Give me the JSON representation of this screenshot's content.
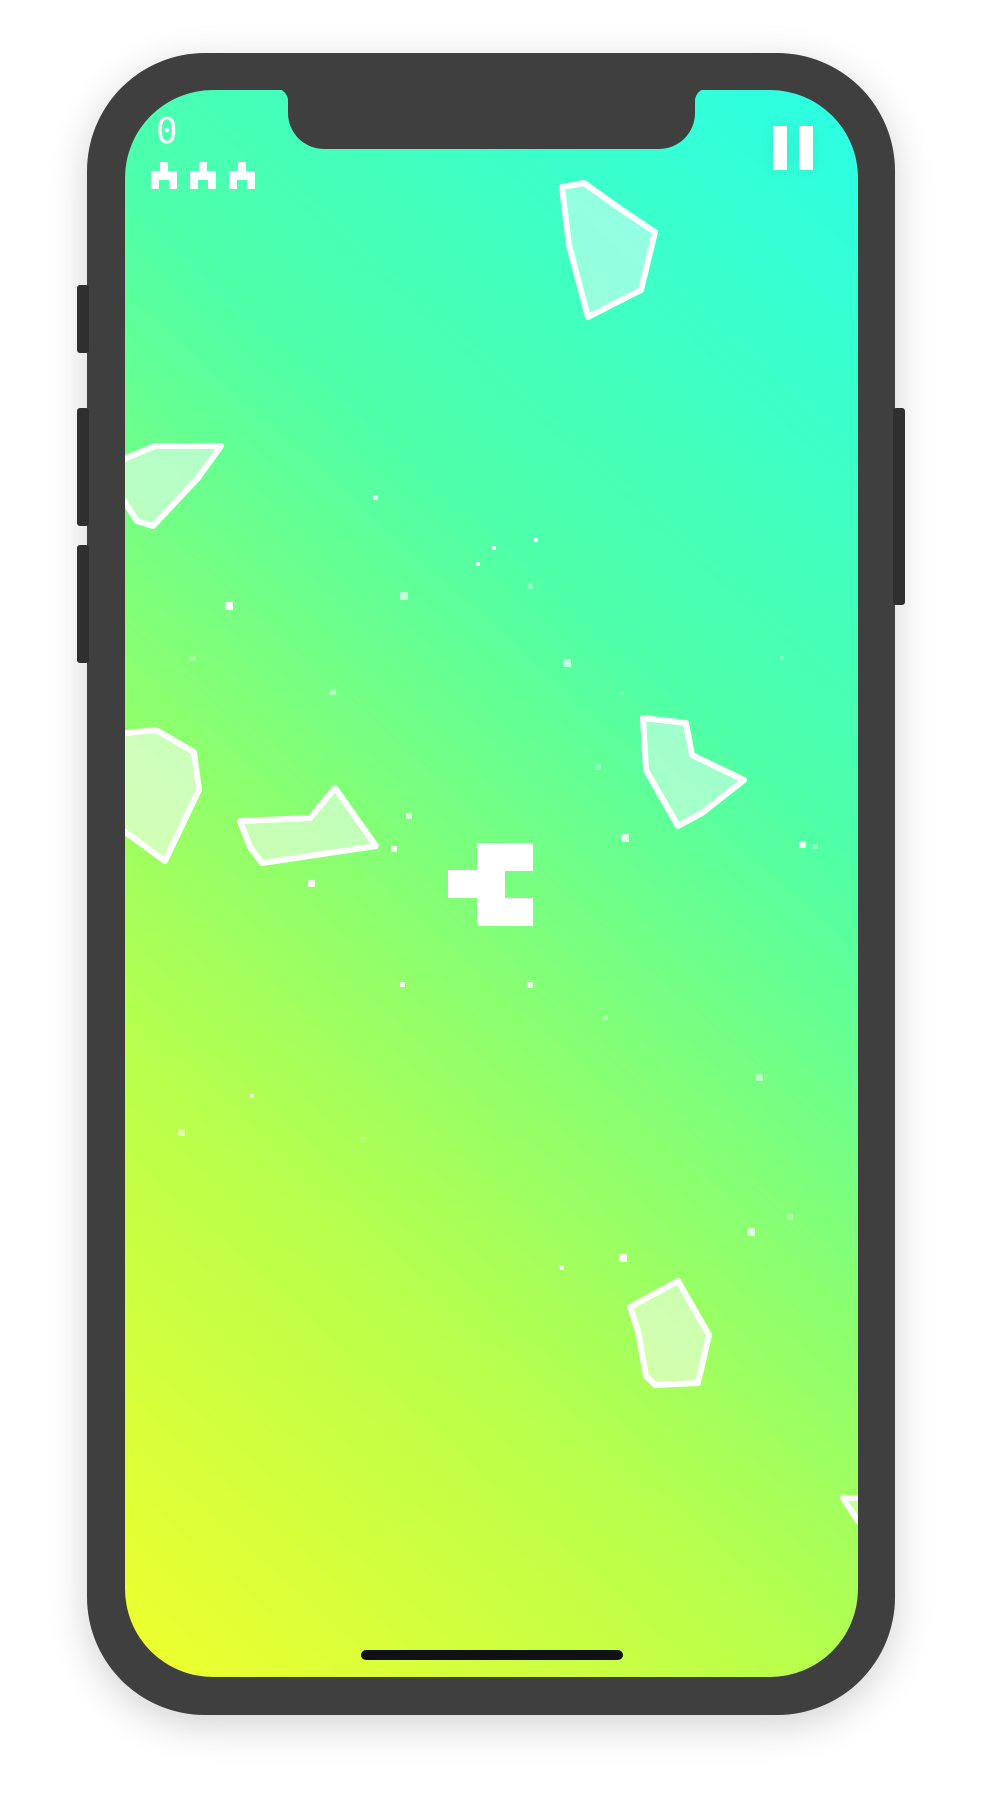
{
  "hud": {
    "score": "0",
    "lives": 3,
    "life_icon": "ship-life-icon",
    "pause_icon": "pause-icon"
  },
  "colors": {
    "frame": "#3f3f3f",
    "gradient_bottom_left": "#f0ff2c",
    "gradient_top_right": "#2bffe6",
    "foreground": "#ffffff"
  },
  "sprites": {
    "player": "player-ship",
    "asteroids": 7,
    "stars": "particles"
  }
}
